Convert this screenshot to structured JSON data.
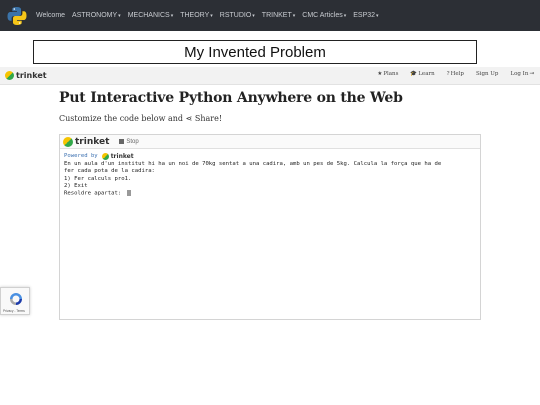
{
  "navbar": {
    "logo_icon": "python-logo-icon",
    "items": [
      {
        "label": "Welcome",
        "has_caret": false
      },
      {
        "label": "ASTRONOMY",
        "has_caret": true
      },
      {
        "label": "MECHANICS",
        "has_caret": true
      },
      {
        "label": "THEORY",
        "has_caret": true
      },
      {
        "label": "RSTUDIO",
        "has_caret": true
      },
      {
        "label": "TRINKET",
        "has_caret": true
      },
      {
        "label": "CMC Articles",
        "has_caret": true
      },
      {
        "label": "ESP32",
        "has_caret": true
      }
    ]
  },
  "page_title": "My Invented Problem",
  "trinket_bar": {
    "logo_text": "trinket",
    "links": [
      {
        "icon": "star-icon",
        "glyph": "★",
        "label": "Plans"
      },
      {
        "icon": "graduation-cap-icon",
        "glyph": "🎓",
        "label": "Learn"
      },
      {
        "icon": "question-circle-icon",
        "glyph": "?",
        "label": "Help"
      },
      {
        "icon": "",
        "glyph": "",
        "label": "Sign Up"
      },
      {
        "icon": "sign-in-icon",
        "glyph": "⇥",
        "label": "Log In"
      }
    ]
  },
  "headline": "Put Interactive Python Anywhere on the Web",
  "subline": {
    "text": "Customize the code below and",
    "share_label": "Share!",
    "share_icon": "share-icon"
  },
  "embed": {
    "logo_text": "trinket",
    "stop_label": "Stop",
    "powered_by": "Powered by",
    "powered_logo": "trinket",
    "console_lines": [
      "En un aula d'un institut hi ha un noi de 70kg sentat a una cadira, amb un pes de 5kg. Calcula la força que ha de",
      "fer cada pota de la cadira:",
      "1) Fer calculs pro1.",
      "2) Exit",
      "Resoldre apartat: "
    ]
  },
  "recaptcha": {
    "text": "Privacy - Terms"
  }
}
